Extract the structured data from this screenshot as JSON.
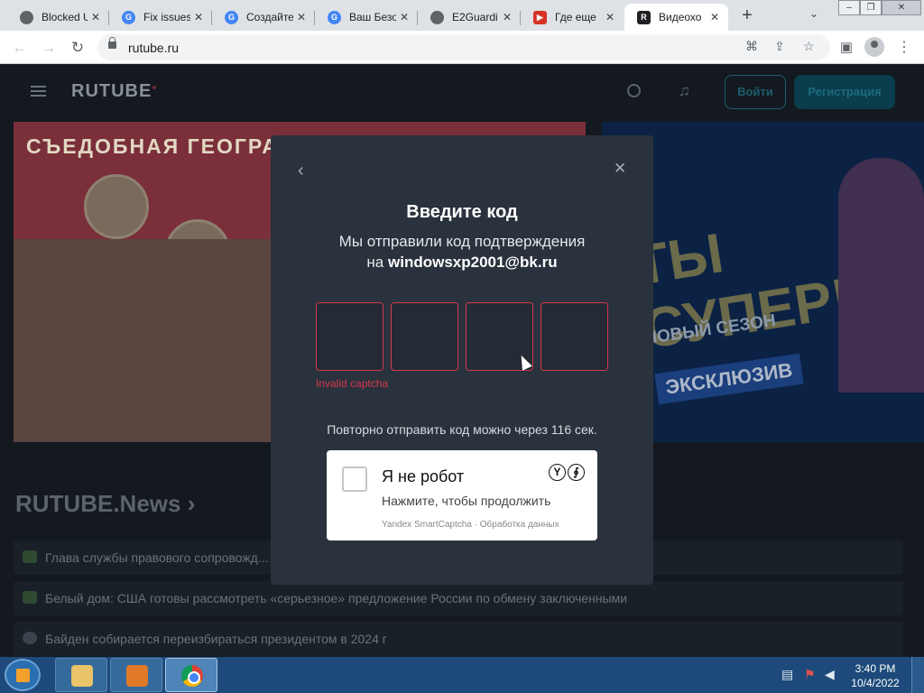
{
  "browser": {
    "tabs": [
      {
        "title": "Blocked U",
        "favicon_color": "#5f6368",
        "active": false
      },
      {
        "title": "Fix issues",
        "favicon_color": "#4285f4",
        "active": false
      },
      {
        "title": "Создайте",
        "favicon_color": "#4285f4",
        "active": false
      },
      {
        "title": "Ваш Безо",
        "favicon_color": "#4285f4",
        "active": false
      },
      {
        "title": "E2Guardi",
        "favicon_color": "#5f6368",
        "active": false
      },
      {
        "title": "Где еще",
        "favicon_color": "#d93025",
        "active": false
      },
      {
        "title": "Видеохо",
        "favicon_color": "#202124",
        "active": true
      }
    ],
    "new_tab_label": "+",
    "close_label": "✕",
    "url": "rutube.ru"
  },
  "site": {
    "logo": "RUTUBE",
    "login_label": "Войти",
    "register_label": "Регистрация",
    "banner1_title": "СЪЕДОБНАЯ ГЕОГРАФ",
    "banner2_big": "ТЫ СУПЕР!",
    "banner2_season": "НОВЫЙ СЕЗОН",
    "banner2_exclusive": "ЭКСКЛЮЗИВ",
    "news_heading": "RUTUBE.News",
    "news": [
      {
        "text": "Глава службы правового сопровожд... блокировке YouTube-каналов"
      },
      {
        "text": "Белый дом: США готовы рассмотреть «серьезное» предложение России по обмену заключенными"
      },
      {
        "text": "Байден собирается переизбираться президентом в 2024 г"
      }
    ]
  },
  "modal": {
    "title": "Введите код",
    "line1": "Мы отправили код подтверждения",
    "line2_prefix": "на",
    "email": "windowsxp2001@bk.ru",
    "code_digits": [
      "",
      "",
      "",
      ""
    ],
    "error": "Invalid captcha",
    "resend": "Повторно отправить код можно через 116 сек.",
    "captcha": {
      "title": "Я не робот",
      "subtitle": "Нажмите, чтобы продолжить",
      "footer": "Yandex SmartCaptcha · Обработка данных"
    }
  },
  "taskbar": {
    "time": "3:40 PM",
    "date": "10/4/2022"
  },
  "colors": {
    "error": "#d4384c",
    "modal_bg": "#2a323d",
    "page_bg": "#14191f"
  }
}
